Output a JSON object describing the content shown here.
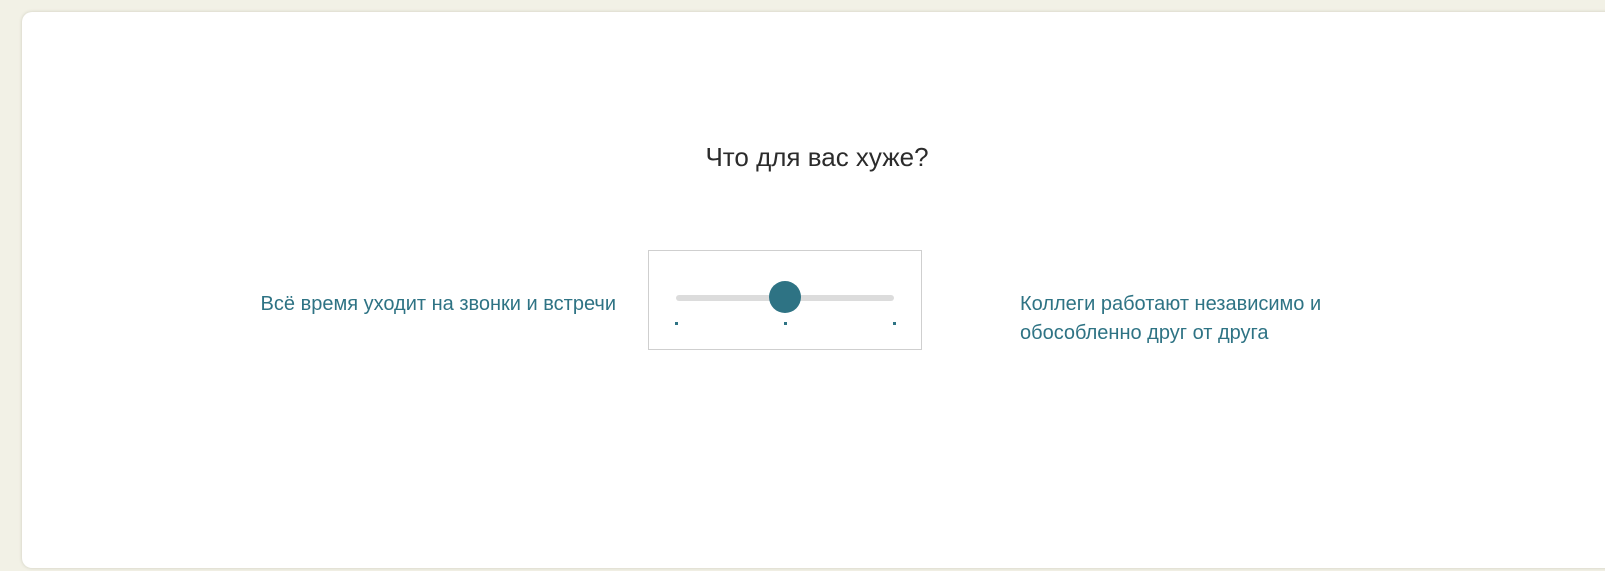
{
  "question": "Что для вас хуже?",
  "option_left": "Всё время уходит на звонки и встречи",
  "option_right": "Коллеги работают независимо и обособленно друг от друга",
  "slider": {
    "value_fraction": 0.5,
    "tick_fractions": [
      0.0,
      0.5,
      1.0
    ],
    "accent_color": "#2e7384",
    "track_color": "#dcdcdc"
  }
}
